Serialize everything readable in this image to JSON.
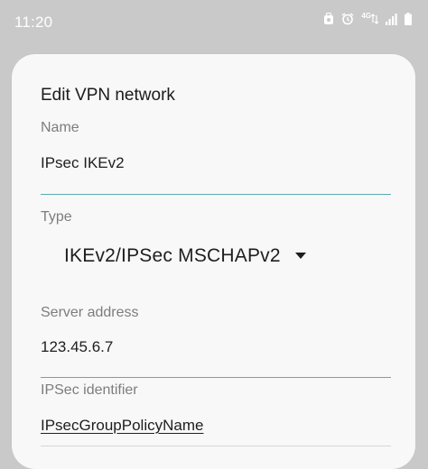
{
  "status_bar": {
    "time": "11:20",
    "network_type": "4G",
    "icons": [
      "carrier-app-icon",
      "alarm-icon",
      "mobile-data-icon",
      "signal-icon",
      "battery-icon"
    ]
  },
  "dialog": {
    "title": "Edit VPN network",
    "name": {
      "label": "Name",
      "value": "IPsec IKEv2"
    },
    "type": {
      "label": "Type",
      "value": "IKEv2/IPSec MSCHAPv2"
    },
    "server_address": {
      "label": "Server address",
      "value": "123.45.6.7"
    },
    "ipsec_identifier": {
      "label": "IPSec identifier",
      "value": "IPsecGroupPolicyName"
    }
  },
  "colors": {
    "accent_underline": "#5aaab6",
    "background": "#c9c9c9",
    "dialog_bg": "#f8f8f8"
  }
}
